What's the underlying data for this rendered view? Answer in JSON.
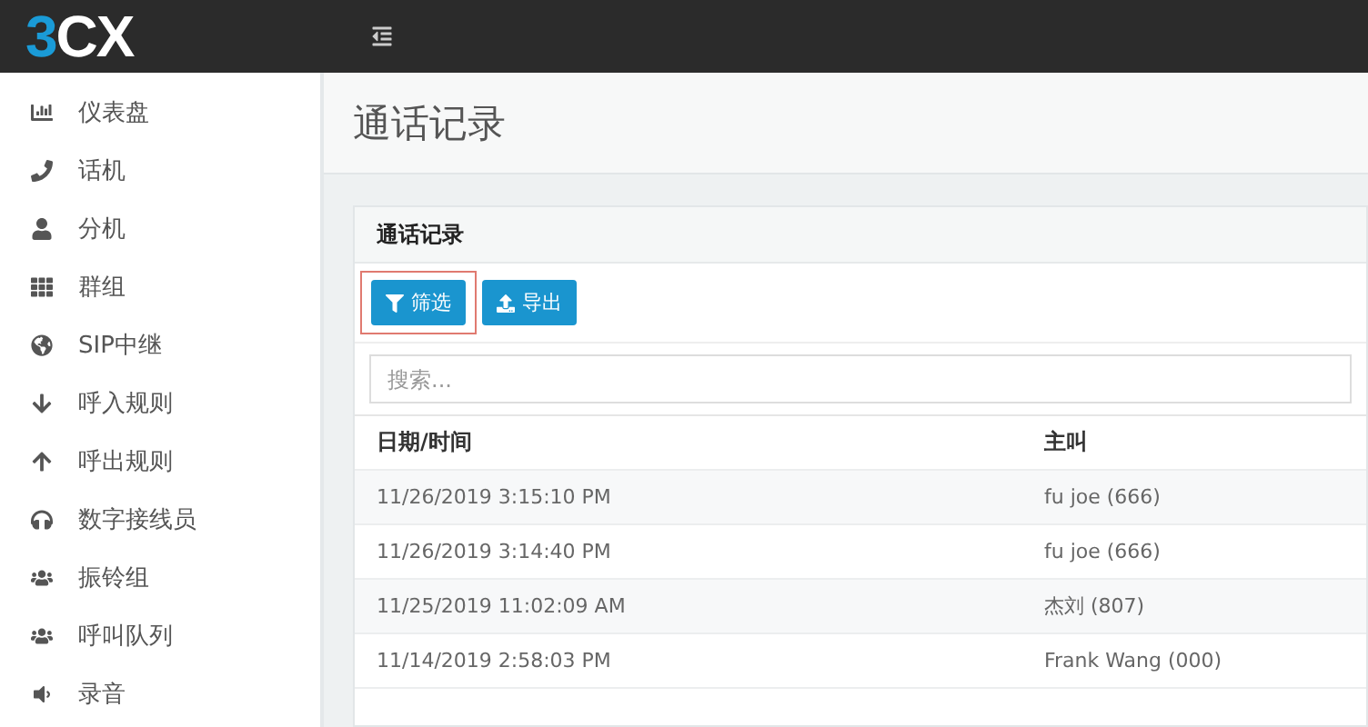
{
  "logo": {
    "mark": "3",
    "text": "CX"
  },
  "sidebar": {
    "items": [
      {
        "label": "仪表盘"
      },
      {
        "label": "话机"
      },
      {
        "label": "分机"
      },
      {
        "label": "群组"
      },
      {
        "label": "SIP中继"
      },
      {
        "label": "呼入规则"
      },
      {
        "label": "呼出规则"
      },
      {
        "label": "数字接线员"
      },
      {
        "label": "振铃组"
      },
      {
        "label": "呼叫队列"
      },
      {
        "label": "录音"
      }
    ]
  },
  "page_title": "通话记录",
  "card": {
    "title": "通话记录",
    "buttons": [
      {
        "label": "筛选",
        "highlighted": true
      },
      {
        "label": "导出",
        "highlighted": false
      }
    ],
    "search": {
      "placeholder": "搜索..."
    },
    "table": {
      "columns": [
        "日期/时间",
        "主叫"
      ],
      "rows": [
        [
          "11/26/2019 3:15:10 PM",
          "fu joe (666)"
        ],
        [
          "11/26/2019 3:14:40 PM",
          "fu joe (666)"
        ],
        [
          "11/25/2019 11:02:09 AM",
          "杰刘 (807)"
        ],
        [
          "11/14/2019 2:58:03 PM",
          "Frank Wang (000)"
        ]
      ]
    }
  }
}
